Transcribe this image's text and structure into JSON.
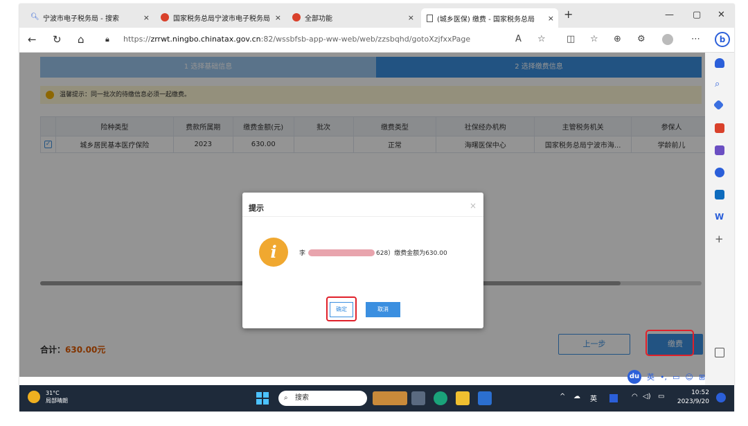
{
  "tabs": [
    {
      "title": "宁波市电子税务局 - 搜索",
      "icon": "search-icon"
    },
    {
      "title": "国家税务总局宁波市电子税务局",
      "icon": "emblem-icon"
    },
    {
      "title": "全部功能",
      "icon": "emblem-icon"
    },
    {
      "title": "(城乡医保) 缴费 - 国家税务总局",
      "icon": "page-icon"
    }
  ],
  "address": {
    "prefix": "https://",
    "host": "zrrwt.ningbo.chinatax.gov.cn",
    "rest": ":82/wssbfsb-app-ww-web/web/zzsbqhd/gotoXzjfxxPage"
  },
  "steps": {
    "step1": "1 选择基础信息",
    "step2": "2 选择缴费信息"
  },
  "tip": "温馨提示：同一批次的待缴信息必须一起缴费。",
  "table": {
    "headers": [
      "",
      "险种类型",
      "费款所属期",
      "缴费金额(元)",
      "批次",
      "缴费类型",
      "社保经办机构",
      "主管税务机关",
      "参保人"
    ],
    "rows": [
      {
        "checked": "✓",
        "type": "城乡居民基本医疗保险",
        "period": "2023",
        "amount": "630.00",
        "batch": "",
        "pay_type": "正常",
        "agency": "海曙医保中心",
        "tax_office": "国家税务总局宁波市海...",
        "insured": "学龄前儿"
      }
    ]
  },
  "footer": {
    "total_label": "合计：",
    "total_value": "630.00元",
    "prev": "上一步",
    "pay": "缴费"
  },
  "dialog": {
    "title": "提示",
    "close": "×",
    "name_prefix": "李",
    "msg_suffix": "628）缴费金额为630.00",
    "ok": "确定",
    "cancel": "取消"
  },
  "ime": {
    "logo": "du",
    "lang": "英"
  },
  "taskbar": {
    "temp": "31°C",
    "weather": "局部晴朗",
    "search": "搜索",
    "lang": "英",
    "time": "10:52",
    "date": "2023/9/20"
  },
  "colors": {
    "accent": "#3b8fe0",
    "highlight": "#e0202a",
    "amount": "#e05a00"
  }
}
